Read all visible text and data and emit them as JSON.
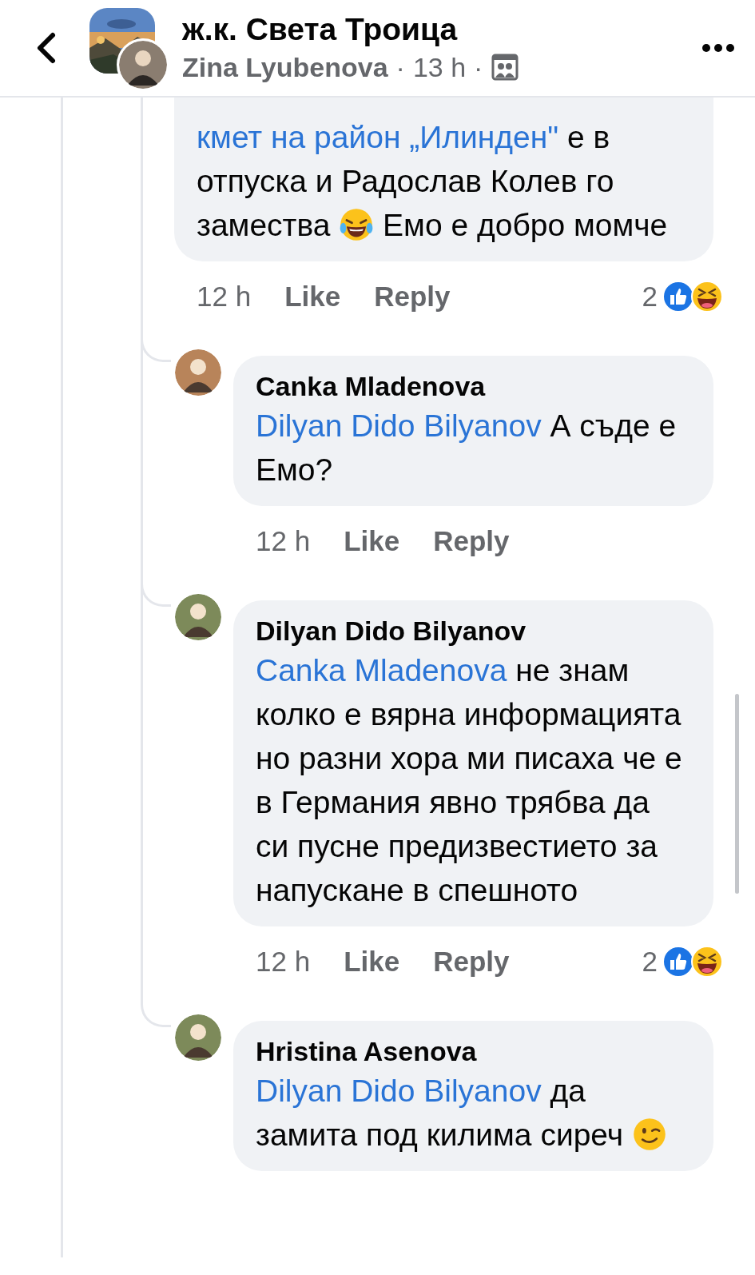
{
  "header": {
    "title": "ж.к. Света Троица",
    "author": "Zina Lyubenova",
    "separator_1": "·",
    "time": "13 h",
    "separator_2": "·"
  },
  "comments": [
    {
      "parts": [
        {
          "kind": "mention",
          "text": "кмет на район „Илинден\""
        },
        {
          "kind": "text",
          "text": " е в отпуска и Радослав Колев го замества "
        },
        {
          "kind": "laugh"
        },
        {
          "kind": "text",
          "text": " Емо е добро момче"
        }
      ],
      "actions": {
        "time": "12 h",
        "like": "Like",
        "reply": "Reply",
        "reaction_count": "2"
      }
    },
    {
      "author": "Canka Mladenova",
      "parts": [
        {
          "kind": "mention",
          "text": "Dilyan Dido Bilyanov"
        },
        {
          "kind": "text",
          "text": " А съде е Емо?"
        }
      ],
      "actions": {
        "time": "12 h",
        "like": "Like",
        "reply": "Reply"
      }
    },
    {
      "author": "Dilyan Dido Bilyanov",
      "parts": [
        {
          "kind": "mention",
          "text": "Canka Mladenova"
        },
        {
          "kind": "text",
          "text": " не знам колко е вярна информацията но разни хора ми писаха че е в Германия явно трябва да си пусне предизвестието за напускане в спешното"
        }
      ],
      "actions": {
        "time": "12 h",
        "like": "Like",
        "reply": "Reply",
        "reaction_count": "2"
      }
    },
    {
      "author": "Hristina Asenova",
      "parts": [
        {
          "kind": "mention",
          "text": "Dilyan Dido Bilyanov"
        },
        {
          "kind": "text",
          "text": " да замита под килима сиреч "
        },
        {
          "kind": "wink"
        }
      ]
    }
  ]
}
